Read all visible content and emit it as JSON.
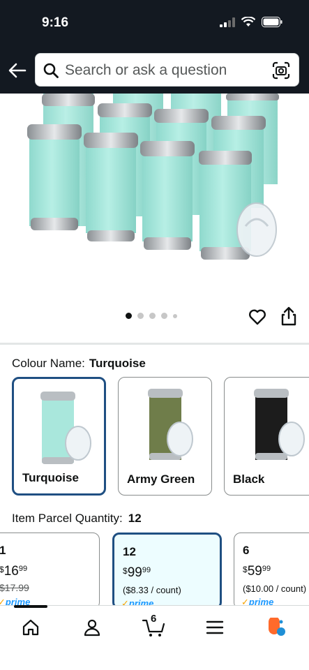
{
  "status_bar": {
    "time": "9:16"
  },
  "search": {
    "placeholder": "Search or ask a question"
  },
  "gallery": {
    "image_count": 5,
    "active_index": 0
  },
  "colour": {
    "label": "Colour Name:",
    "selected": "Turquoise",
    "options": [
      {
        "name": "Turquoise",
        "color": "#a9e7dc"
      },
      {
        "name": "Army Green",
        "color": "#6f7d4a"
      },
      {
        "name": "Black",
        "color": "#1c1c1c"
      }
    ]
  },
  "quantity": {
    "label": "Item Parcel Quantity:",
    "selected": "12",
    "options": [
      {
        "count": "1",
        "currency": "$",
        "whole": "16",
        "cents": "99",
        "list_price": "$17.99",
        "unit": "",
        "prime": "prime"
      },
      {
        "count": "12",
        "currency": "$",
        "whole": "99",
        "cents": "99",
        "list_price": "",
        "unit": "($8.33 / count)",
        "prime": "prime"
      },
      {
        "count": "6",
        "currency": "$",
        "whole": "59",
        "cents": "99",
        "list_price": "",
        "unit": "($10.00 / count)",
        "prime": "prime"
      }
    ]
  },
  "bottom_nav": {
    "cart_count": "6"
  },
  "colors": {
    "header": "#131921",
    "selected_border": "#1f4f82",
    "prime_blue": "#1a98ff"
  }
}
